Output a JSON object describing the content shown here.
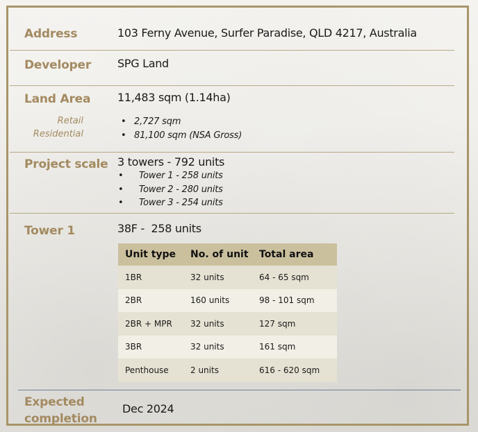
{
  "address": {
    "label": "Address",
    "value": "103 Ferny Avenue, Surfer Paradise, QLD 4217, Australia"
  },
  "developer": {
    "label": "Developer",
    "value": "SPG Land"
  },
  "land_area": {
    "label": "Land Area",
    "value": "11,483 sqm (1.14ha)",
    "sub_labels": [
      "Retail",
      "Residential"
    ],
    "items": [
      "2,727 sqm",
      "81,100 sqm (NSA Gross)"
    ]
  },
  "project_scale": {
    "label": "Project scale",
    "value": "3 towers - 792 units",
    "items": [
      "Tower 1 - 258 units",
      "Tower 2 - 280 units",
      "Tower 3 - 254 units"
    ]
  },
  "tower1": {
    "label": "Tower 1",
    "value": "38F -  258 units",
    "table": {
      "headers": [
        "Unit type",
        "No. of unit",
        "Total area"
      ],
      "rows": [
        [
          "1BR",
          "32 units",
          "64 - 65 sqm"
        ],
        [
          "2BR",
          "160 units",
          "98 - 101 sqm"
        ],
        [
          "2BR + MPR",
          "32 units",
          "127 sqm"
        ],
        [
          "3BR",
          "32 units",
          "161 sqm"
        ],
        [
          "Penthouse",
          "2 units",
          "616 - 620 sqm"
        ]
      ]
    }
  },
  "expected_completion": {
    "label_line1": "Expected",
    "label_line2": "completion",
    "value": "Dec 2024"
  },
  "colors": {
    "label_gold": "#a38a60",
    "frame_gold": "#a8956a",
    "table_header": "#cbc09e",
    "divider_blue": "#6f7f96"
  }
}
